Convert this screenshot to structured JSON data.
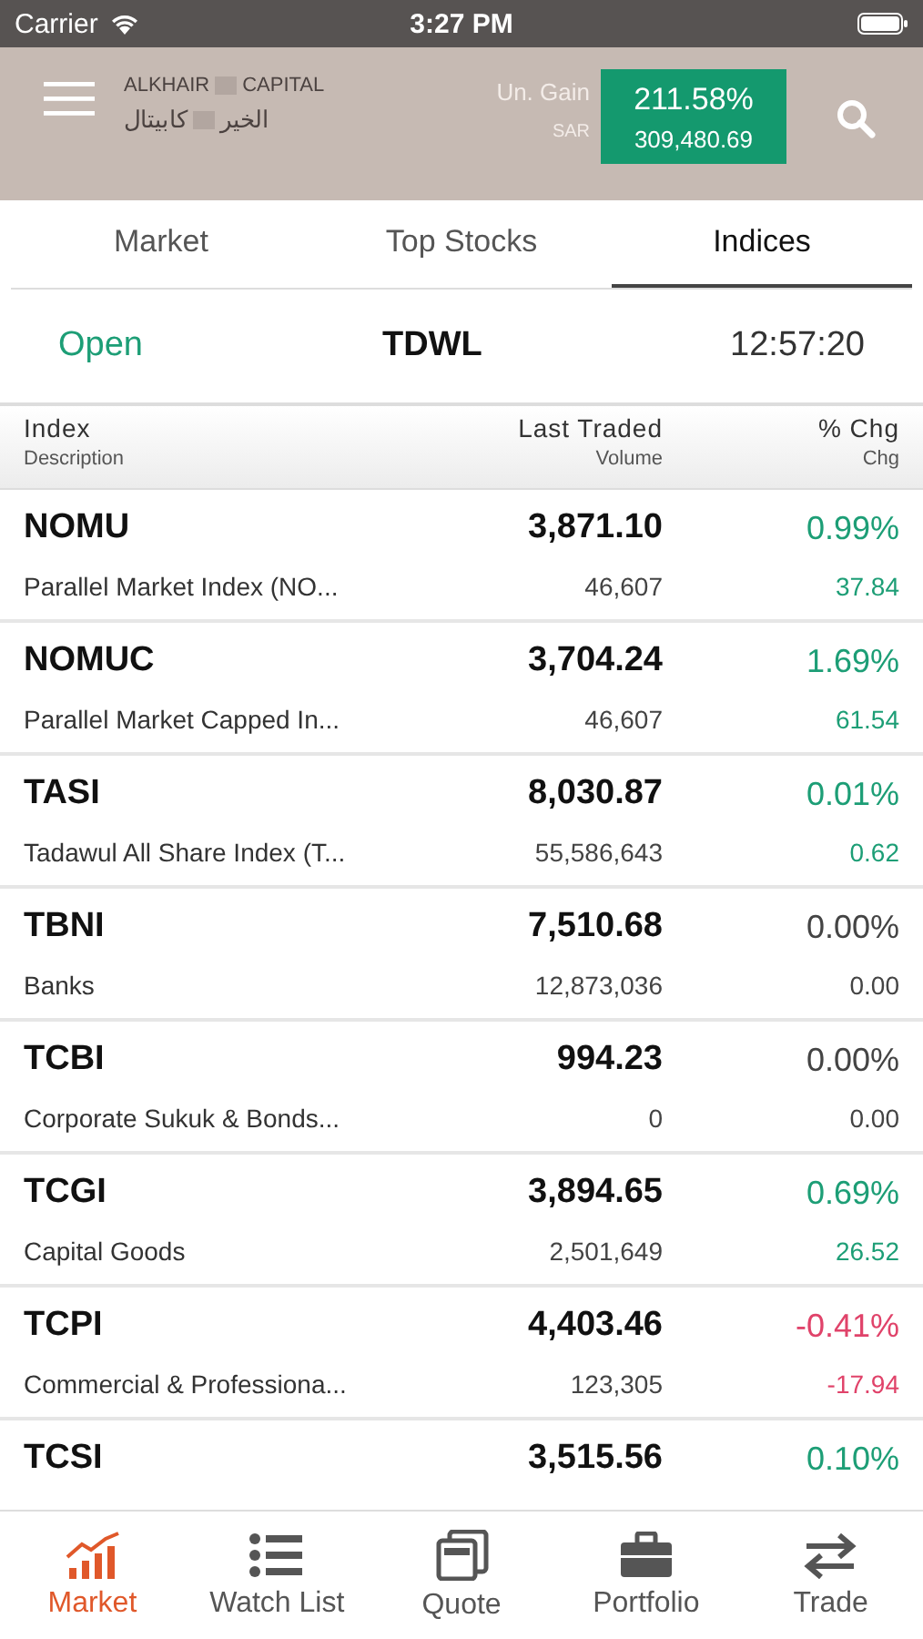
{
  "status_bar": {
    "carrier": "Carrier",
    "time": "3:27 PM"
  },
  "header": {
    "logo": {
      "latin": [
        "ALKHAIR",
        "CAPITAL"
      ],
      "arabic": [
        "الخير",
        "كابيتال"
      ]
    },
    "gain_label": "Un. Gain",
    "gain_value": "211.58%",
    "currency": "SAR",
    "amount": "309,480.69"
  },
  "tabs": [
    {
      "label": "Market",
      "selected": false
    },
    {
      "label": "Top Stocks",
      "selected": false
    },
    {
      "label": "Indices",
      "selected": true
    }
  ],
  "market_status": {
    "state": "Open",
    "exchange": "TDWL",
    "time": "12:57:20"
  },
  "table": {
    "columns": [
      {
        "title": "Index",
        "subtitle": "Description"
      },
      {
        "title": "Last Traded",
        "subtitle": "Volume"
      },
      {
        "title": "% Chg",
        "subtitle": "Chg"
      }
    ],
    "rows": [
      {
        "code": "NOMU",
        "description": "Parallel Market Index (NO...",
        "price": "3,871.10",
        "volume": "46,607",
        "pct": "0.99%",
        "chg": "37.84",
        "color": "#1d9e76"
      },
      {
        "code": "NOMUC",
        "description": "Parallel Market Capped In...",
        "price": "3,704.24",
        "volume": "46,607",
        "pct": "1.69%",
        "chg": "61.54",
        "color": "#1d9e76"
      },
      {
        "code": "TASI",
        "description": "Tadawul All Share Index (T...",
        "price": "8,030.87",
        "volume": "55,586,643",
        "pct": "0.01%",
        "chg": "0.62",
        "color": "#1d9e76"
      },
      {
        "code": "TBNI",
        "description": "Banks",
        "price": "7,510.68",
        "volume": "12,873,036",
        "pct": "0.00%",
        "chg": "0.00",
        "color": "#444444"
      },
      {
        "code": "TCBI",
        "description": "Corporate Sukuk & Bonds...",
        "price": "994.23",
        "volume": "0",
        "pct": "0.00%",
        "chg": "0.00",
        "color": "#444444"
      },
      {
        "code": "TCGI",
        "description": "Capital Goods",
        "price": "3,894.65",
        "volume": "2,501,649",
        "pct": "0.69%",
        "chg": "26.52",
        "color": "#1d9e76"
      },
      {
        "code": "TCPI",
        "description": "Commercial & Professiona...",
        "price": "4,403.46",
        "volume": "123,305",
        "pct": "-0.41%",
        "chg": "-17.94",
        "color": "#e0436a"
      },
      {
        "code": "TCSI",
        "price": "3,515.56",
        "pct": "0.10%",
        "color": "#1d9e76"
      }
    ]
  },
  "bottom_nav": [
    {
      "label": "Market",
      "kind": "chart",
      "selected": true
    },
    {
      "label": "Watch List",
      "kind": "list",
      "selected": false
    },
    {
      "label": "Quote",
      "kind": "quote",
      "selected": false
    },
    {
      "label": "Portfolio",
      "kind": "briefcase",
      "selected": false
    },
    {
      "label": "Trade",
      "kind": "swap",
      "selected": false
    }
  ]
}
